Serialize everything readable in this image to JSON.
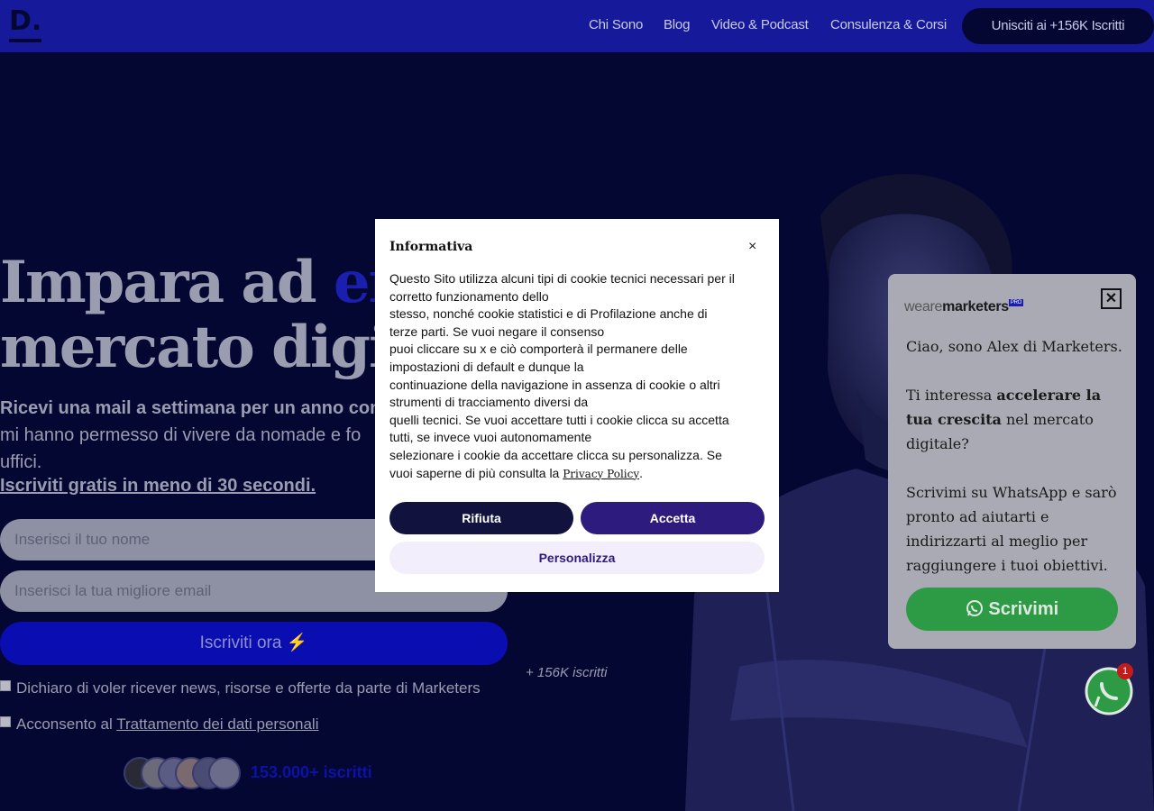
{
  "header": {
    "logo": "D.",
    "nav": [
      "Chi Sono",
      "Blog",
      "Video & Podcast",
      "Consulenza & Corsi"
    ],
    "cta": "Unisciti ai +156K Iscritti"
  },
  "hero": {
    "title_line1_a": "Impara ad ",
    "title_line1_accent": "em",
    "title_line2": "mercato digit",
    "subtitle_bold": "Ricevi una mail a settimana per un anno con",
    "subtitle_rest_1": "mi hanno permesso di vivere da nomade e fo",
    "subtitle_rest_2": "uffici.",
    "signup_link": "Iscriviti gratis in meno di 30 secondi.",
    "name_placeholder": "Inserisci il tuo nome",
    "email_placeholder": "Inserisci la tua migliore email",
    "submit": "Iscriviti ora ⚡",
    "subscribers_note": "+ 156K iscritti",
    "consent_news": "Dichiaro di voler ricever news, risorse e offerte da parte di Marketers",
    "consent_data_prefix": "Acconsento al ",
    "consent_data_link": "Trattamento dei dati personali",
    "avatar_count": "153.000+ iscritti"
  },
  "cookie_modal": {
    "title": "Informativa",
    "close": "×",
    "lines": [
      "Questo Sito utilizza alcuni tipi di cookie tecnici necessari per il",
      "corretto funzionamento dello",
      "stesso, nonché cookie statistici e di Profilazione anche di",
      "terze parti. Se vuoi negare il consenso",
      "puoi cliccare su x e ciò comporterà il permanere delle",
      "impostazioni di default e dunque la",
      "continuazione della navigazione in assenza di cookie o altri",
      "strumenti di tracciamento diversi da",
      "quelli tecnici. Se vuoi accettare tutti i cookie clicca su accetta",
      "tutti, se invece vuoi autonomamente",
      "selezionare i cookie da accettare clicca su personalizza. Se"
    ],
    "last_line_prefix": "vuoi saperne di più consulta la ",
    "privacy_link": "Privacy Policy",
    "last_line_suffix": ".",
    "reject": "Rifiuta",
    "accept": "Accetta",
    "customize": "Personalizza"
  },
  "chat": {
    "brand_light": "weare",
    "brand_bold": "marketers",
    "brand_badge": "PRO",
    "close": "✕",
    "greeting": "Ciao, sono Alex di Marketers.",
    "q_prefix": "Ti interessa ",
    "q_bold": "accelerare la tua crescita",
    "q_suffix": " nel mercato digitale?",
    "body": "Scrivimi su WhatsApp e sarò pronto ad aiutarti e indirizzarti al meglio per raggiungere i tuoi obiettivi.",
    "button": "Scrivimi",
    "fab_badge": "1"
  },
  "colors": {
    "header_bg": "#16199a",
    "page_bg": "#050733",
    "accent": "#1b1fb0",
    "whatsapp": "#2d9a45",
    "accept_btn": "#2d1b7e",
    "reject_btn": "#11123d"
  }
}
